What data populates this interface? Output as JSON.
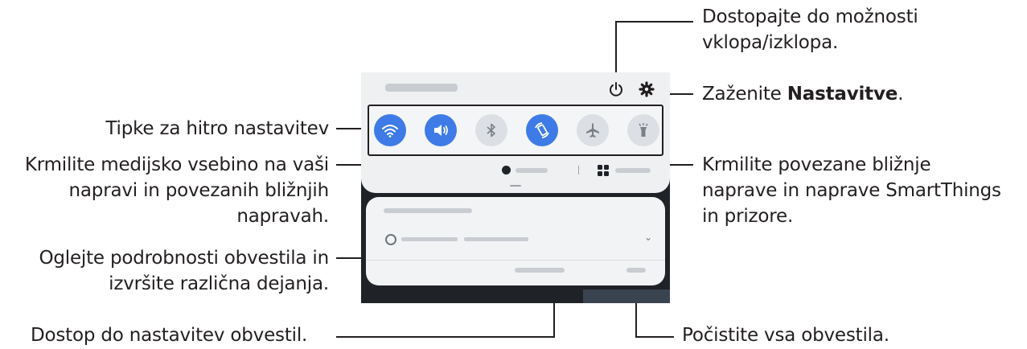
{
  "callouts": {
    "power": {
      "line1": "Dostopajte do možnosti",
      "line2": "vklopa/izklopa."
    },
    "settings": {
      "prefix": "Zaženite ",
      "bold": "Nastavitve",
      "suffix": "."
    },
    "quick_settings": "Tipke za hitro nastavitev",
    "media": {
      "line1": "Krmilite medijsko vsebino na vaši",
      "line2": "napravi in povezanih bližnjih",
      "line3": "napravah."
    },
    "devices": {
      "line1": "Krmilite povezane bližnje",
      "line2": "naprave in naprave SmartThings",
      "line3": "in prizore."
    },
    "notification_details": {
      "line1": "Oglejte podrobnosti obvestila in",
      "line2": "izvršite različna dejanja."
    },
    "notification_settings": "Dostop do nastavitev obvestil.",
    "clear_all": "Počistite vsa obvestila."
  },
  "quick_settings_buttons": [
    {
      "icon": "wifi-icon",
      "state": "on"
    },
    {
      "icon": "sound-icon",
      "state": "on"
    },
    {
      "icon": "bluetooth-icon",
      "state": "off"
    },
    {
      "icon": "auto-rotate-icon",
      "state": "on"
    },
    {
      "icon": "airplane-mode-icon",
      "state": "off"
    },
    {
      "icon": "flashlight-icon",
      "state": "off"
    }
  ],
  "colors": {
    "accent": "#3e7be6",
    "panel_dark": "#1f2328",
    "panel_light": "#eef0f2",
    "text": "#231f20"
  }
}
